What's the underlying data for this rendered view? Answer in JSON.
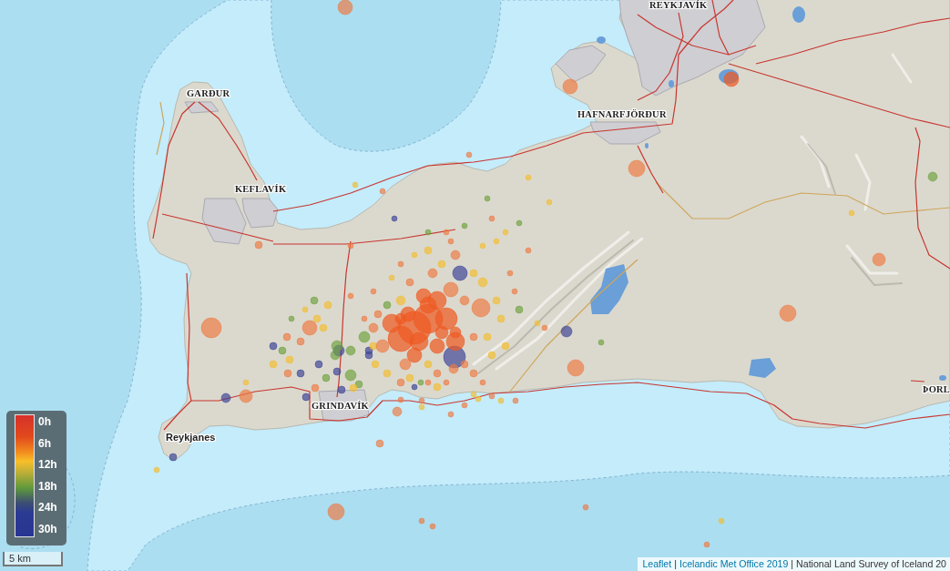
{
  "map": {
    "place_labels": [
      {
        "text": "REYKJAVÍK",
        "kind": "town"
      },
      {
        "text": "GARÐUR",
        "kind": "town"
      },
      {
        "text": "HAFNARFJÖRÐUR",
        "kind": "town"
      },
      {
        "text": "KEFLAVÍK",
        "kind": "town"
      },
      {
        "text": "ÞORL",
        "kind": "town"
      },
      {
        "text": "GRINDAVÍK",
        "kind": "town"
      },
      {
        "text": "Reykjanes",
        "kind": "locality"
      }
    ]
  },
  "legend": {
    "labels": [
      "0h",
      "6h",
      "12h",
      "18h",
      "24h",
      "30h"
    ]
  },
  "scale_bar": {
    "label": "5 km"
  },
  "attribution": [
    {
      "kind": "link",
      "text": "Leaflet"
    },
    {
      "kind": "separator",
      "text": "|"
    },
    {
      "kind": "link",
      "text": "Icelandic Met Office 2019"
    },
    {
      "kind": "separator",
      "text": "|"
    },
    {
      "kind": "text",
      "text": "National Land Survey of Iceland 20"
    }
  ]
}
